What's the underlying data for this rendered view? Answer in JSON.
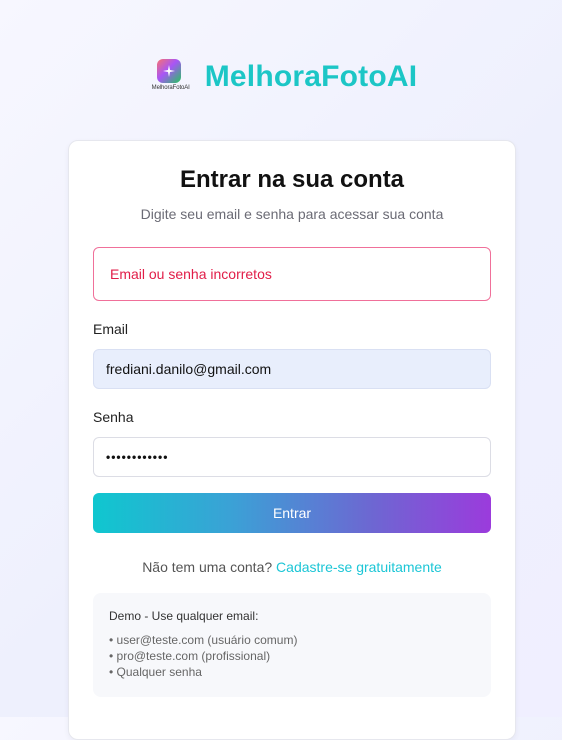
{
  "brand": {
    "name": "MelhoraFotoAI",
    "logo_caption": "MelhoraFotoAI",
    "accent_color": "#1cc6c6"
  },
  "card": {
    "title": "Entrar na sua conta",
    "subtitle": "Digite seu email e senha para acessar sua conta"
  },
  "error": {
    "message": "Email ou senha incorretos",
    "color": "#e11d48"
  },
  "form": {
    "email_label": "Email",
    "email_value": "frediani.danilo@gmail.com",
    "password_label": "Senha",
    "password_value": "••••••••••••",
    "submit_label": "Entrar"
  },
  "signup": {
    "prompt": "Não tem uma conta?",
    "link_label": "Cadastre-se gratuitamente"
  },
  "demo": {
    "title": "Demo - Use qualquer email:",
    "lines": [
      "• user@teste.com (usuário comum)",
      "• pro@teste.com (profissional)",
      "• Qualquer senha"
    ]
  }
}
